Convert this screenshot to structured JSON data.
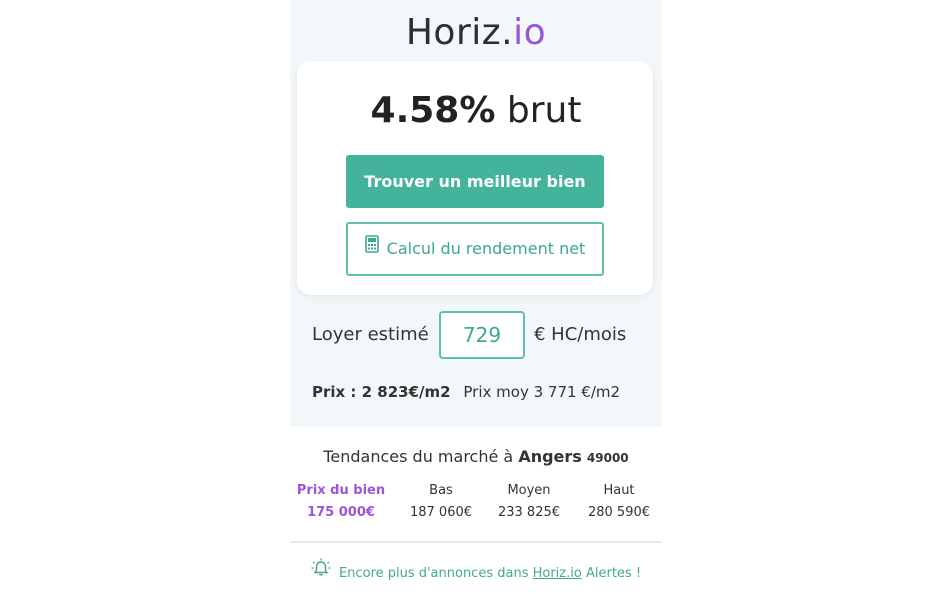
{
  "logo": {
    "main": "Horiz.",
    "accent": "io"
  },
  "yield": {
    "value": "4.58%",
    "suffix": "brut"
  },
  "buttons": {
    "primary": "Trouver un meilleur bien",
    "secondary": "Calcul du rendement net"
  },
  "rent": {
    "label": "Loyer estimé",
    "value": "729",
    "unit": "€ HC/mois"
  },
  "price": {
    "label": "Prix : 2 823€/m2",
    "average": "Prix moy 3 771 €/m2"
  },
  "trends": {
    "title_prefix": "Tendances du marché à",
    "city": "Angers",
    "zip": "49000",
    "columns": [
      {
        "label": "Prix du bien",
        "value": "175 000€"
      },
      {
        "label": "Bas",
        "value": "187 060€"
      },
      {
        "label": "Moyen",
        "value": "233 825€"
      },
      {
        "label": "Haut",
        "value": "280 590€"
      }
    ]
  },
  "alert": {
    "prefix": "Encore plus d'annonces dans",
    "link": "Horiz.io",
    "suffix": "Alertes !"
  },
  "colors": {
    "accent_green": "#44b39c",
    "accent_purple": "#9b55d6",
    "panel_background": "#f2f7f9"
  },
  "icons": {
    "secondary_button": "calculator-icon",
    "alert": "bell-icon"
  }
}
